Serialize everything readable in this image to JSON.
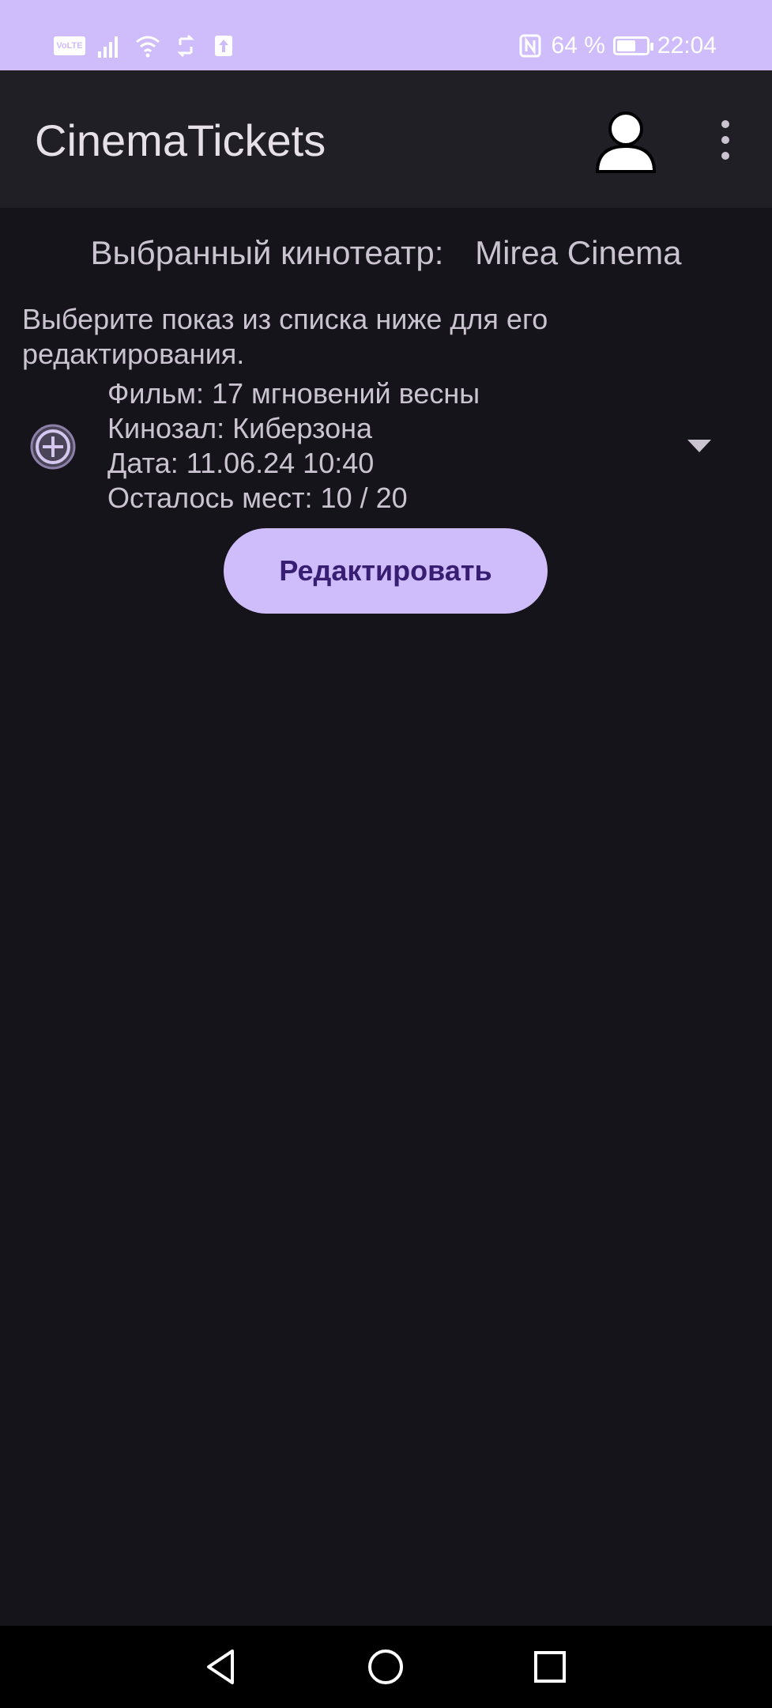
{
  "status_bar": {
    "volte": "VoLTE",
    "battery_text": "64 %",
    "battery_level_percent": 64,
    "time": "22:04",
    "icons": [
      "volte-icon",
      "signal-icon",
      "wifi-icon",
      "sync-icon",
      "upload-icon",
      "nfc-icon",
      "battery-icon"
    ]
  },
  "app_bar": {
    "title": "CinemaTickets",
    "profile_icon": "person-icon",
    "menu_icon": "more-vert-icon"
  },
  "cinema": {
    "label": "Выбранный кинотеатр:",
    "value": "Mirea Cinema"
  },
  "instructions": "Выберите показ из списка ниже для его редактирования.",
  "show": {
    "add_icon": "add-circle-icon",
    "film": "Фильм: 17 мгновений весны",
    "hall": "Кинозал: Киберзона",
    "date": "Дата: 11.06.24 10:40",
    "seats": "Осталось мест: 10 / 20",
    "dropdown_icon": "arrow-drop-down-icon"
  },
  "edit_button": "Редактировать",
  "nav_bar": {
    "icons": [
      "back-icon",
      "home-icon",
      "recents-icon"
    ]
  },
  "colors": {
    "accent": "#cfbcfb",
    "background": "#16141b",
    "app_bar": "#211f26",
    "button_text": "#381e72"
  }
}
